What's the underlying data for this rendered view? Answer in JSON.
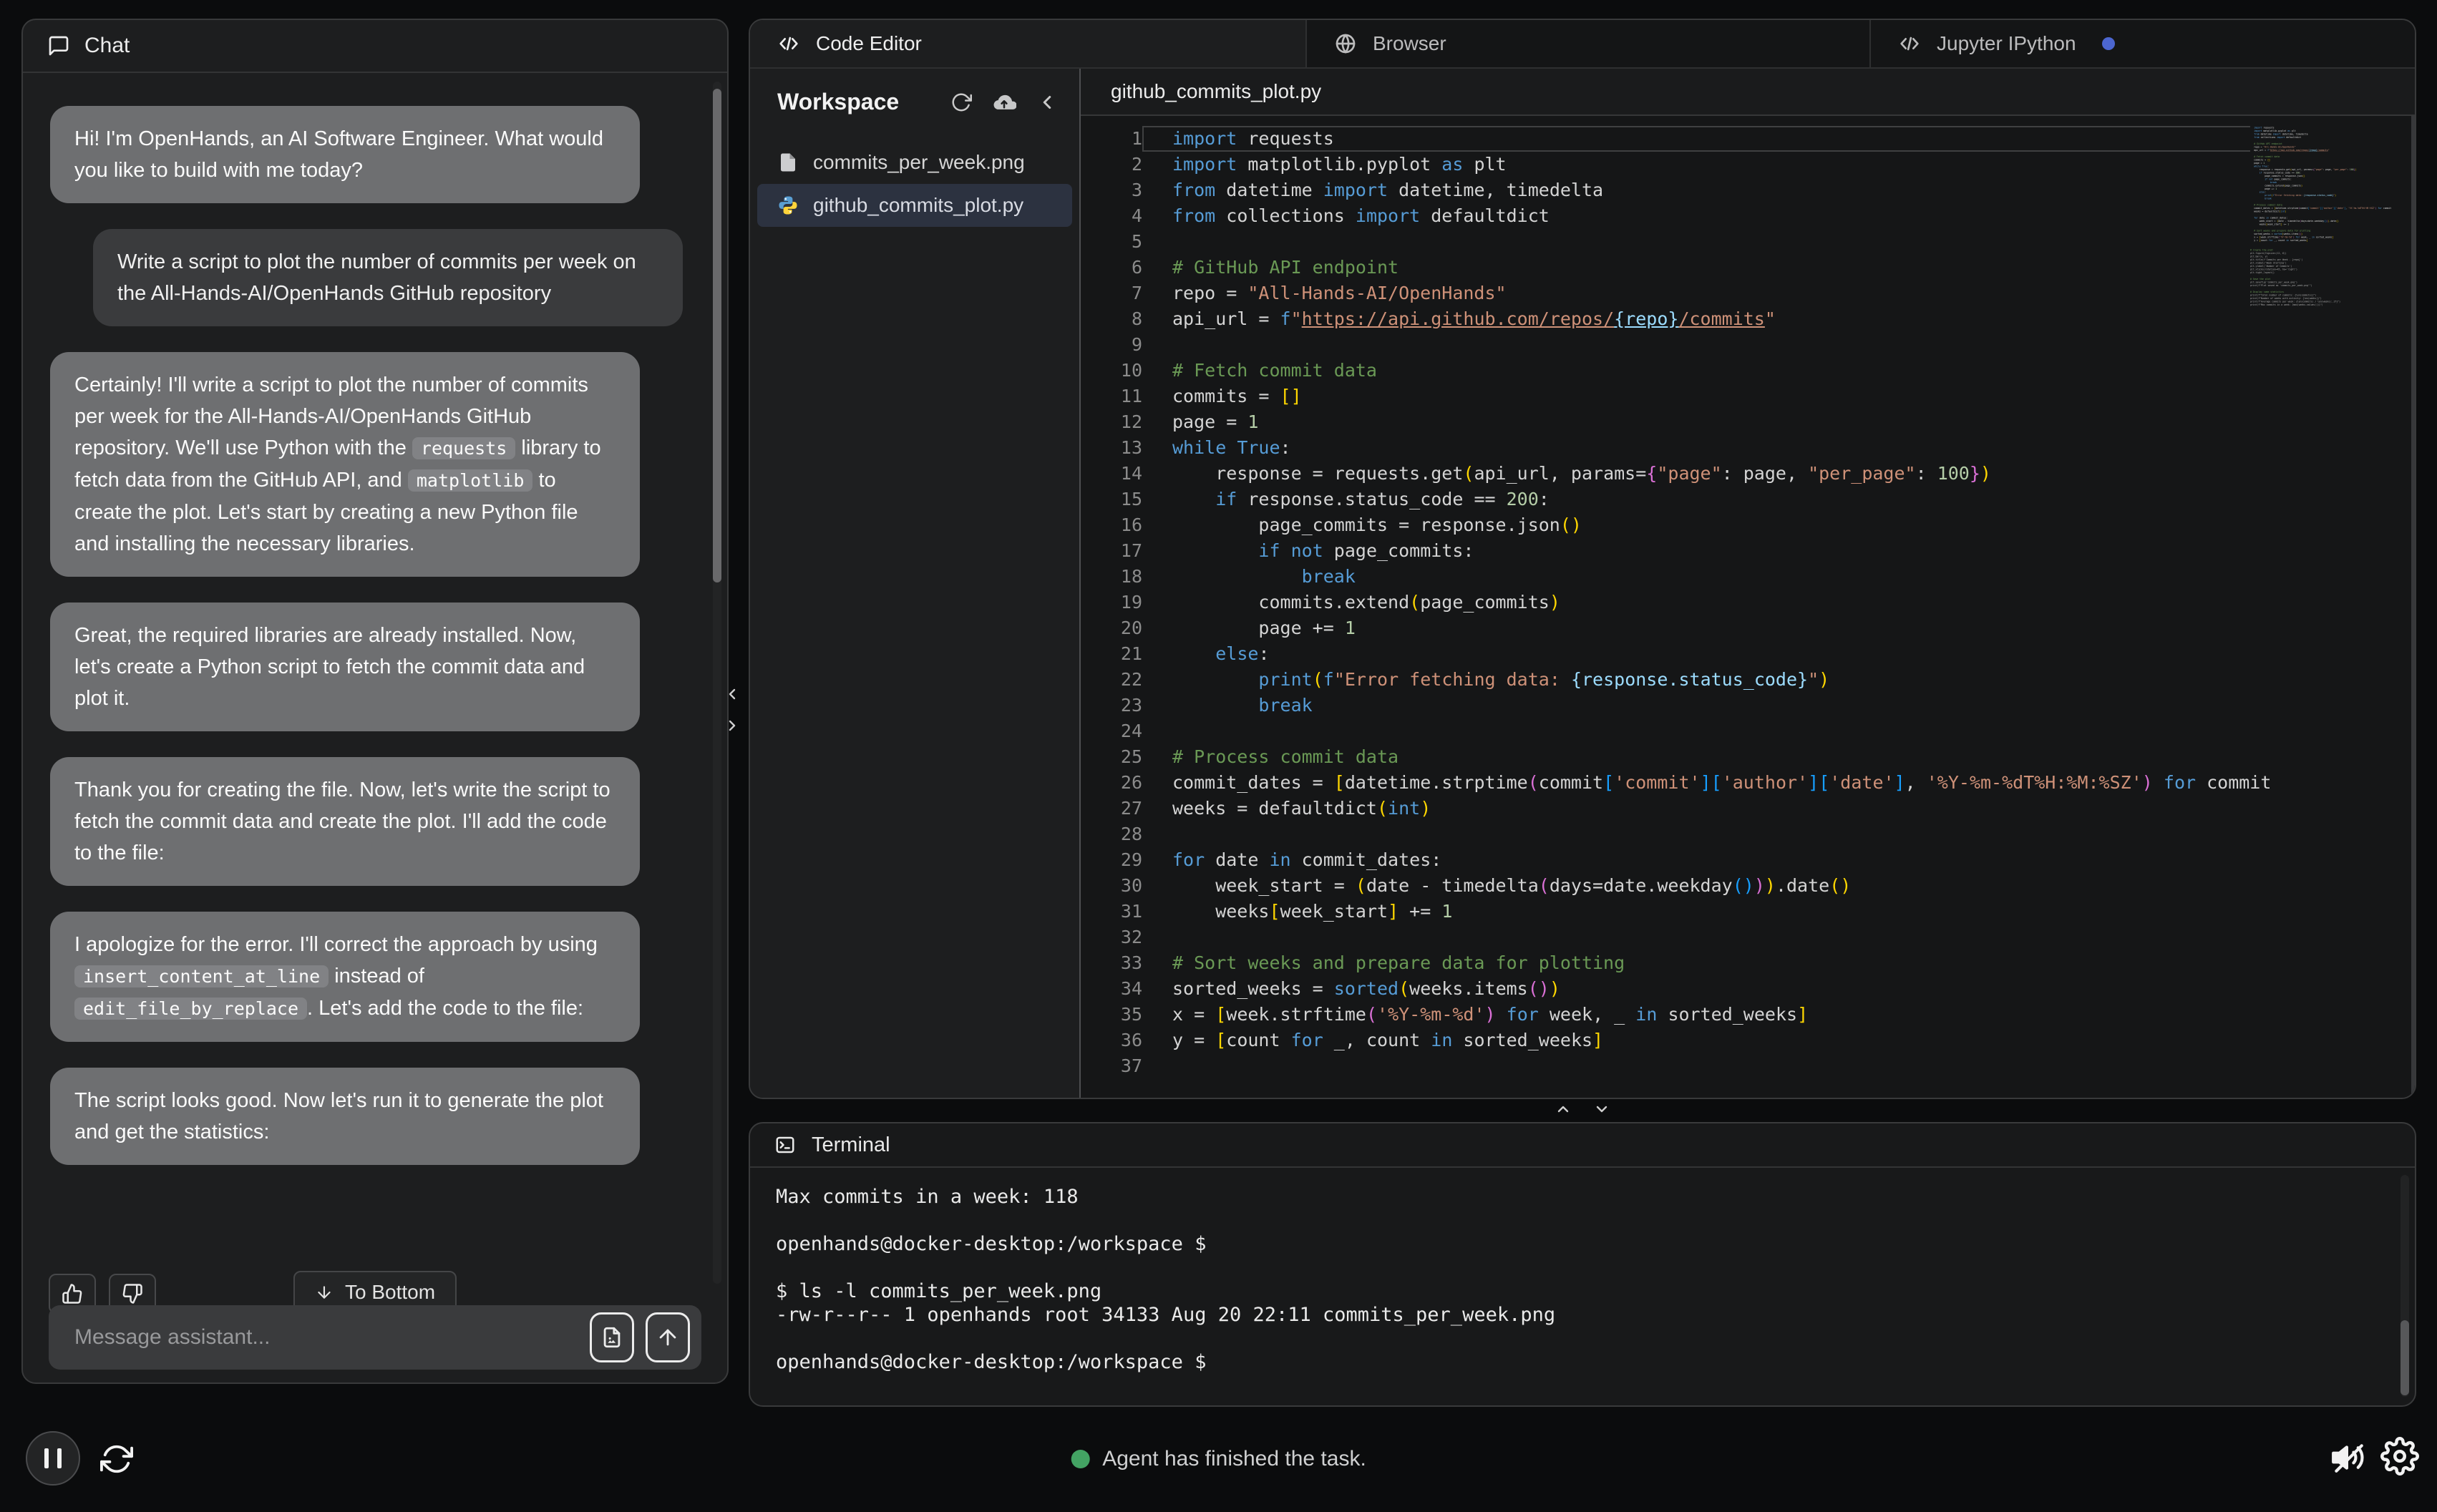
{
  "chat": {
    "title": "Chat",
    "messages": [
      {
        "role": "assistant",
        "parts": [
          [
            "text",
            "Hi! I'm OpenHands, an AI Software Engineer. What would you like to build with me today?"
          ]
        ]
      },
      {
        "role": "user",
        "parts": [
          [
            "text",
            "Write a script to plot the number of commits per week on the All-Hands-AI/OpenHands GitHub repository"
          ]
        ]
      },
      {
        "role": "assistant",
        "parts": [
          [
            "text",
            "Certainly! I'll write a script to plot the number of commits per week for the All-Hands-AI/OpenHands GitHub repository. We'll use Python with the "
          ],
          [
            "code",
            "requests"
          ],
          [
            "text",
            " library to fetch data from the GitHub API, and "
          ],
          [
            "code",
            "matplotlib"
          ],
          [
            "text",
            " to create the plot. Let's start by creating a new Python file and installing the necessary libraries."
          ]
        ]
      },
      {
        "role": "assistant",
        "parts": [
          [
            "text",
            "Great, the required libraries are already installed. Now, let's create a Python script to fetch the commit data and plot it."
          ]
        ]
      },
      {
        "role": "assistant",
        "parts": [
          [
            "text",
            "Thank you for creating the file. Now, let's write the script to fetch the commit data and create the plot. I'll add the code to the file:"
          ]
        ]
      },
      {
        "role": "assistant",
        "parts": [
          [
            "text",
            "I apologize for the error. I'll correct the approach by using "
          ],
          [
            "code",
            "insert_content_at_line"
          ],
          [
            "text",
            " instead of "
          ],
          [
            "code",
            "edit_file_by_replace"
          ],
          [
            "text",
            ". Let's add the code to the file:"
          ]
        ]
      },
      {
        "role": "assistant",
        "parts": [
          [
            "text",
            "The script looks good. Now let's run it to generate the plot and get the statistics:"
          ]
        ]
      }
    ],
    "to_bottom_label": "To Bottom",
    "input_placeholder": "Message assistant..."
  },
  "status": {
    "text": "Agent has finished the task."
  },
  "tabs": [
    {
      "label": "Code Editor",
      "icon": "code-icon",
      "active": true
    },
    {
      "label": "Browser",
      "icon": "globe-icon",
      "active": false
    },
    {
      "label": "Jupyter IPython",
      "icon": "code-icon",
      "active": false,
      "dot": true
    }
  ],
  "workspace": {
    "title": "Workspace",
    "files": [
      {
        "name": "commits_per_week.png",
        "icon": "file",
        "selected": false
      },
      {
        "name": "github_commits_plot.py",
        "icon": "python",
        "selected": true
      }
    ]
  },
  "editor": {
    "filename": "github_commits_plot.py",
    "lines": [
      {
        "n": 1,
        "cur": true,
        "t": [
          [
            "kw",
            "import"
          ],
          [
            "pl",
            " requests"
          ]
        ]
      },
      {
        "n": 2,
        "t": [
          [
            "kw",
            "import"
          ],
          [
            "pl",
            " matplotlib.pyplot "
          ],
          [
            "kw",
            "as"
          ],
          [
            "pl",
            " plt"
          ]
        ]
      },
      {
        "n": 3,
        "t": [
          [
            "kw",
            "from"
          ],
          [
            "pl",
            " datetime "
          ],
          [
            "kw",
            "import"
          ],
          [
            "pl",
            " datetime, timedelta"
          ]
        ]
      },
      {
        "n": 4,
        "t": [
          [
            "kw",
            "from"
          ],
          [
            "pl",
            " collections "
          ],
          [
            "kw",
            "import"
          ],
          [
            "pl",
            " defaultdict"
          ]
        ]
      },
      {
        "n": 5,
        "t": []
      },
      {
        "n": 6,
        "t": [
          [
            "com",
            "# GitHub API endpoint"
          ]
        ]
      },
      {
        "n": 7,
        "t": [
          [
            "pl",
            "repo = "
          ],
          [
            "str",
            "\"All-Hands-AI/OpenHands\""
          ]
        ]
      },
      {
        "n": 8,
        "t": [
          [
            "pl",
            "api_url = "
          ],
          [
            "kw",
            "f"
          ],
          [
            "str",
            "\""
          ],
          [
            "stru",
            "https://api.github.com/repos/"
          ],
          [
            "intu",
            "{repo}"
          ],
          [
            "stru",
            "/commits"
          ],
          [
            "str",
            "\""
          ]
        ]
      },
      {
        "n": 9,
        "t": []
      },
      {
        "n": 10,
        "t": [
          [
            "com",
            "# Fetch commit data"
          ]
        ]
      },
      {
        "n": 11,
        "t": [
          [
            "pl",
            "commits = "
          ],
          [
            "b1",
            "[]"
          ]
        ]
      },
      {
        "n": 12,
        "t": [
          [
            "pl",
            "page = "
          ],
          [
            "num",
            "1"
          ]
        ]
      },
      {
        "n": 13,
        "t": [
          [
            "kw",
            "while"
          ],
          [
            "pl",
            " "
          ],
          [
            "kw",
            "True"
          ],
          [
            "pl",
            ":"
          ]
        ]
      },
      {
        "n": 14,
        "t": [
          [
            "pl",
            "    response = requests.get"
          ],
          [
            "b1",
            "("
          ],
          [
            "pl",
            "api_url, params="
          ],
          [
            "b2",
            "{"
          ],
          [
            "str",
            "\"page\""
          ],
          [
            "pl",
            ": page, "
          ],
          [
            "str",
            "\"per_page\""
          ],
          [
            "pl",
            ": "
          ],
          [
            "num",
            "100"
          ],
          [
            "b2",
            "}"
          ],
          [
            "b1",
            ")"
          ]
        ]
      },
      {
        "n": 15,
        "t": [
          [
            "pl",
            "    "
          ],
          [
            "kw",
            "if"
          ],
          [
            "pl",
            " response.status_code == "
          ],
          [
            "num",
            "200"
          ],
          [
            "pl",
            ":"
          ]
        ]
      },
      {
        "n": 16,
        "t": [
          [
            "pl",
            "        page_commits = response.json"
          ],
          [
            "b1",
            "()"
          ]
        ]
      },
      {
        "n": 17,
        "t": [
          [
            "pl",
            "        "
          ],
          [
            "kw",
            "if"
          ],
          [
            "pl",
            " "
          ],
          [
            "kw",
            "not"
          ],
          [
            "pl",
            " page_commits:"
          ]
        ]
      },
      {
        "n": 18,
        "t": [
          [
            "pl",
            "            "
          ],
          [
            "kw",
            "break"
          ]
        ]
      },
      {
        "n": 19,
        "t": [
          [
            "pl",
            "        commits.extend"
          ],
          [
            "b1",
            "("
          ],
          [
            "pl",
            "page_commits"
          ],
          [
            "b1",
            ")"
          ]
        ]
      },
      {
        "n": 20,
        "t": [
          [
            "pl",
            "        page += "
          ],
          [
            "num",
            "1"
          ]
        ]
      },
      {
        "n": 21,
        "t": [
          [
            "pl",
            "    "
          ],
          [
            "kw",
            "else"
          ],
          [
            "pl",
            ":"
          ]
        ]
      },
      {
        "n": 22,
        "t": [
          [
            "pl",
            "        "
          ],
          [
            "fn",
            "print"
          ],
          [
            "b1",
            "("
          ],
          [
            "kw",
            "f"
          ],
          [
            "str",
            "\"Error fetching data: "
          ],
          [
            "int",
            "{response.status_code}"
          ],
          [
            "str",
            "\""
          ],
          [
            "b1",
            ")"
          ]
        ]
      },
      {
        "n": 23,
        "t": [
          [
            "pl",
            "        "
          ],
          [
            "kw",
            "break"
          ]
        ]
      },
      {
        "n": 24,
        "t": []
      },
      {
        "n": 25,
        "t": [
          [
            "com",
            "# Process commit data"
          ]
        ]
      },
      {
        "n": 26,
        "t": [
          [
            "pl",
            "commit_dates = "
          ],
          [
            "b1",
            "["
          ],
          [
            "pl",
            "datetime.strptime"
          ],
          [
            "b2",
            "("
          ],
          [
            "pl",
            "commit"
          ],
          [
            "b3",
            "["
          ],
          [
            "str",
            "'commit'"
          ],
          [
            "b3",
            "]"
          ],
          [
            "b3",
            "["
          ],
          [
            "str",
            "'author'"
          ],
          [
            "b3",
            "]"
          ],
          [
            "b3",
            "["
          ],
          [
            "str",
            "'date'"
          ],
          [
            "b3",
            "]"
          ],
          [
            "pl",
            ", "
          ],
          [
            "str",
            "'%Y-%m-%dT%H:%M:%SZ'"
          ],
          [
            "b2",
            ")"
          ],
          [
            "pl",
            " "
          ],
          [
            "kw",
            "for"
          ],
          [
            "pl",
            " commit"
          ]
        ]
      },
      {
        "n": 27,
        "t": [
          [
            "pl",
            "weeks = defaultdict"
          ],
          [
            "b1",
            "("
          ],
          [
            "typ",
            "int"
          ],
          [
            "b1",
            ")"
          ]
        ]
      },
      {
        "n": 28,
        "t": []
      },
      {
        "n": 29,
        "t": [
          [
            "kw",
            "for"
          ],
          [
            "pl",
            " date "
          ],
          [
            "kw",
            "in"
          ],
          [
            "pl",
            " commit_dates:"
          ]
        ]
      },
      {
        "n": 30,
        "t": [
          [
            "pl",
            "    week_start = "
          ],
          [
            "b1",
            "("
          ],
          [
            "pl",
            "date - timedelta"
          ],
          [
            "b2",
            "("
          ],
          [
            "pl",
            "days=date.weekday"
          ],
          [
            "b3",
            "()"
          ],
          [
            "b2",
            ")"
          ],
          [
            "b1",
            ")"
          ],
          [
            "pl",
            ".date"
          ],
          [
            "b1",
            "()"
          ]
        ]
      },
      {
        "n": 31,
        "t": [
          [
            "pl",
            "    weeks"
          ],
          [
            "b1",
            "["
          ],
          [
            "pl",
            "week_start"
          ],
          [
            "b1",
            "]"
          ],
          [
            "pl",
            " += "
          ],
          [
            "num",
            "1"
          ]
        ]
      },
      {
        "n": 32,
        "t": []
      },
      {
        "n": 33,
        "t": [
          [
            "com",
            "# Sort weeks and prepare data for plotting"
          ]
        ]
      },
      {
        "n": 34,
        "t": [
          [
            "pl",
            "sorted_weeks = "
          ],
          [
            "fn",
            "sorted"
          ],
          [
            "b1",
            "("
          ],
          [
            "pl",
            "weeks.items"
          ],
          [
            "b2",
            "()"
          ],
          [
            "b1",
            ")"
          ]
        ]
      },
      {
        "n": 35,
        "t": [
          [
            "pl",
            "x = "
          ],
          [
            "b1",
            "["
          ],
          [
            "pl",
            "week.strftime"
          ],
          [
            "b2",
            "("
          ],
          [
            "str",
            "'%Y-%m-%d'"
          ],
          [
            "b2",
            ")"
          ],
          [
            "pl",
            " "
          ],
          [
            "kw",
            "for"
          ],
          [
            "pl",
            " week, _ "
          ],
          [
            "kw",
            "in"
          ],
          [
            "pl",
            " sorted_weeks"
          ],
          [
            "b1",
            "]"
          ]
        ]
      },
      {
        "n": 36,
        "t": [
          [
            "pl",
            "y = "
          ],
          [
            "b1",
            "["
          ],
          [
            "pl",
            "count "
          ],
          [
            "kw",
            "for"
          ],
          [
            "pl",
            " _, count "
          ],
          [
            "kw",
            "in"
          ],
          [
            "pl",
            " sorted_weeks"
          ],
          [
            "b1",
            "]"
          ]
        ]
      },
      {
        "n": 37,
        "t": []
      }
    ],
    "minimap_extra": [
      "",
      "# Create the plot",
      "plt.figure(figsize=(12, 6))",
      "plt.bar(x, y)",
      "plt.title(f'Commits per Week - {repo}')",
      "plt.xlabel('Week Starting')",
      "plt.ylabel('Number of Commits')",
      "plt.xticks(rotation=45, ha='right')",
      "plt.tight_layout()",
      "",
      "# Save the plot",
      "plt.savefig('commits_per_week.png')",
      "print(f\"Plot saved as 'commits_per_week.png'\")",
      "",
      "# Display some statistics",
      "print(f\"Total number of commits: {len(commits)}\")",
      "print(f\"Number of weeks with activity: {len(weeks)}\")",
      "print(f\"Average commits per week: {len(commits) / len(weeks):.2f}\")",
      "print(f\"Max commits in a week: {max(weeks.values())}\")"
    ]
  },
  "terminal": {
    "title": "Terminal",
    "lines": [
      "Max commits in a week: 118",
      "",
      "openhands@docker-desktop:/workspace $",
      "",
      "$ ls -l commits_per_week.png",
      "-rw-r--r-- 1 openhands root 34133 Aug 20 22:11 commits_per_week.png",
      "",
      "openhands@docker-desktop:/workspace $"
    ]
  },
  "colors": {
    "accent_blue_dot": "#4c66d0",
    "status_green": "#43a363",
    "selection_row": "#2c3240"
  }
}
